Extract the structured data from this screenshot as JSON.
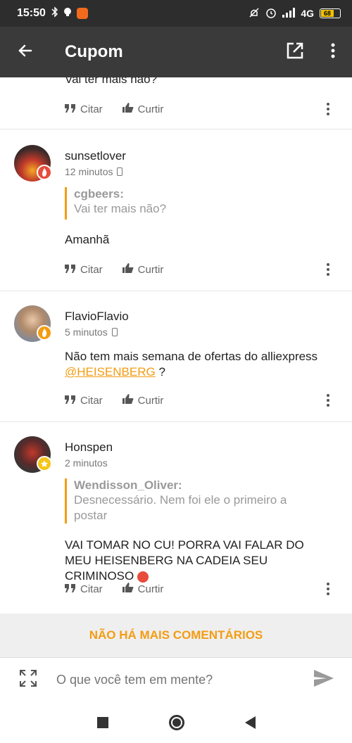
{
  "status_bar": {
    "time": "15:50",
    "network": "4G",
    "battery": "68",
    "battery_level": 0.68
  },
  "app_bar": {
    "title": "Cupom",
    "icons": [
      "back-arrow-icon",
      "open-external-icon",
      "more-vert-icon"
    ]
  },
  "comments": [
    {
      "username": "",
      "meta": "",
      "body": "Vai ter mais não?",
      "cite_label": "Citar",
      "like_label": "Curtir"
    },
    {
      "username": "sunsetlover",
      "meta": "12 minutos",
      "quote_user": "cgbeers:",
      "quote_text": "Vai ter mais não?",
      "body": "Amanhã",
      "cite_label": "Citar",
      "like_label": "Curtir",
      "badge_color": "#e74c3c"
    },
    {
      "username": "FlavioFlavio",
      "meta": "5 minutos",
      "body": "Não tem mais semana de ofertas do alliexpress",
      "mention": "@HEISENBERG",
      "body_suffix": " ?",
      "cite_label": "Citar",
      "like_label": "Curtir",
      "badge_color": "#f39c12"
    },
    {
      "username": "Honspen",
      "meta": "2 minutos",
      "quote_user": "Wendisson_Oliver:",
      "quote_text": "Desnecessário. Nem foi ele o primeiro a postar",
      "body": "VAI TOMAR NO CU! PORRA VAI FALAR DO MEU HEISENBERG NA CADEIA SEU CRIMINOSO",
      "cite_label": "Citar",
      "like_label": "Curtir",
      "badge_color": "#f5c518"
    }
  ],
  "end_banner": "NÃO HÁ MAIS COMENTÁRIOS",
  "composer": {
    "placeholder": "O que você tem em mente?"
  },
  "colors": {
    "accent": "#f39c12",
    "app_bar": "#3a3a3a",
    "status_bar": "#2d2d2d"
  }
}
